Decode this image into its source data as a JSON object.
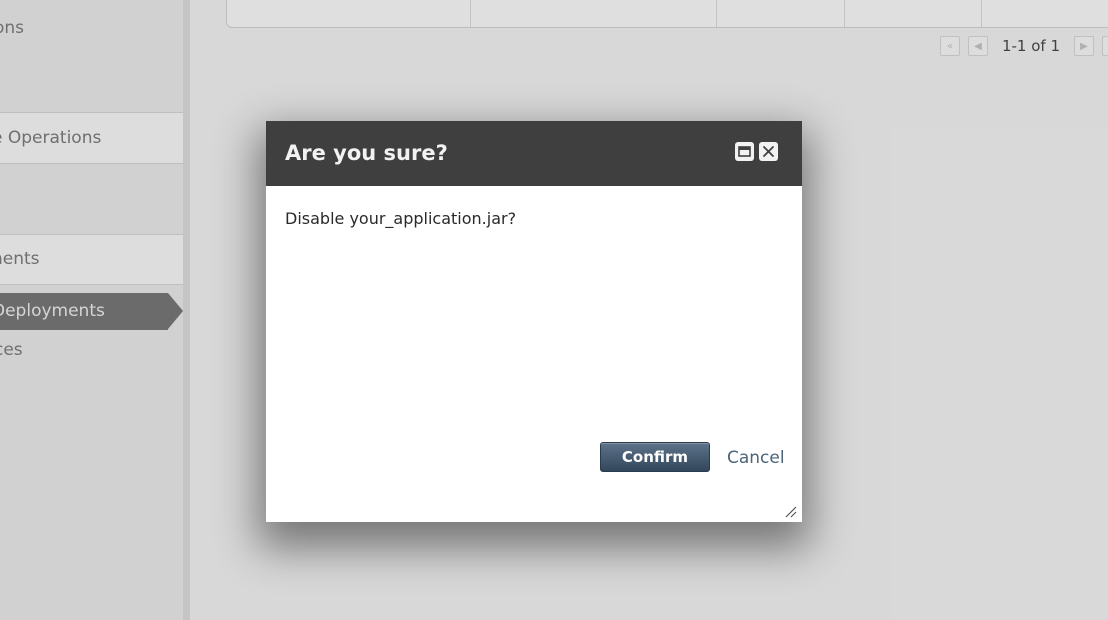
{
  "sidebar": {
    "sections": [
      {
        "label": "ons"
      },
      {
        "label": "e Operations"
      },
      {
        "label": "nents"
      }
    ],
    "items": [
      {
        "label": "Deployments"
      },
      {
        "label": "ces"
      }
    ]
  },
  "main": {
    "pager": {
      "first_icon": "first-page-icon",
      "prev_icon": "previous-page-icon",
      "next_icon": "next-page-icon",
      "range_text": "1-1 of 1"
    }
  },
  "dialog": {
    "title": "Are you sure?",
    "message": "Disable your_application.jar?",
    "confirm_label": "Confirm",
    "cancel_label": "Cancel",
    "icons": {
      "maximize": "maximize-icon",
      "close": "close-icon",
      "resize": "resize-grip-icon"
    }
  },
  "colors": {
    "dialog_header": "#3f3f3f",
    "confirm_button": "#3d5266",
    "cancel_link": "#4b6478",
    "sidebar_active": "#6a6a6a"
  }
}
